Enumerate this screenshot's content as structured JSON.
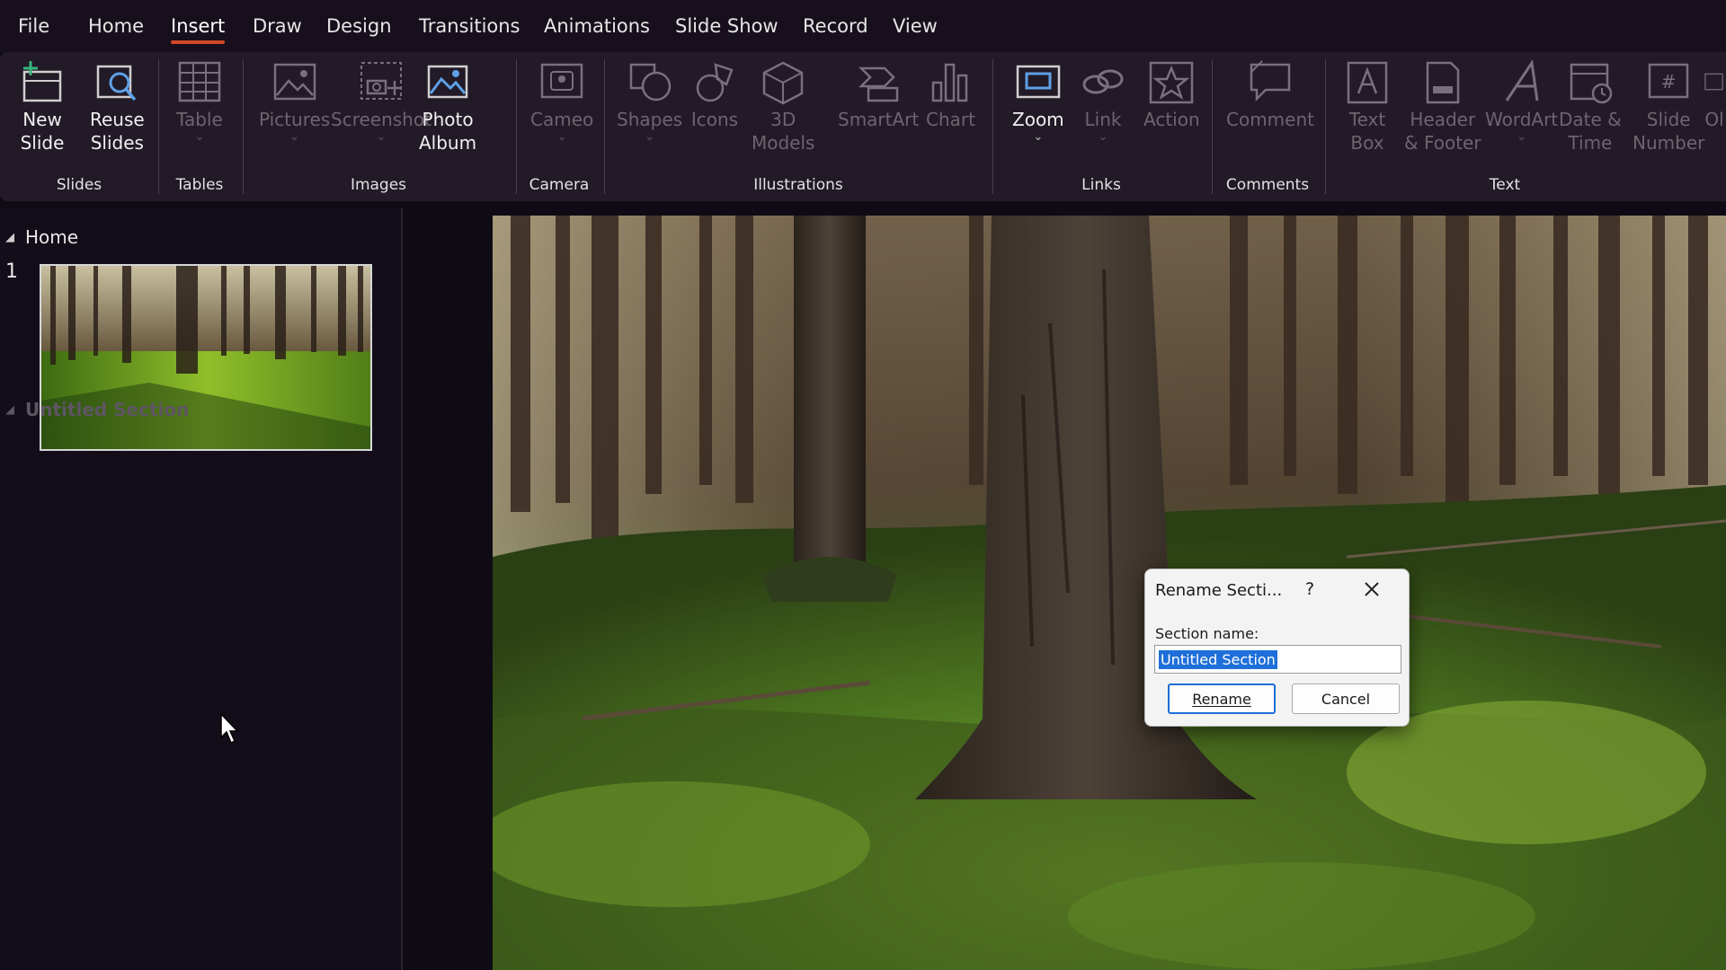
{
  "menu": {
    "items": [
      "File",
      "Home",
      "Insert",
      "Draw",
      "Design",
      "Transitions",
      "Animations",
      "Slide Show",
      "Record",
      "View"
    ],
    "active": "Insert",
    "accent_color": "#d24726"
  },
  "ribbon": {
    "groups": {
      "slides": "Slides",
      "tables": "Tables",
      "images": "Images",
      "camera": "Camera",
      "illustrations": "Illustrations",
      "links": "Links",
      "comments": "Comments",
      "text": "Text"
    },
    "buttons": {
      "new_slide": "New\nSlide",
      "reuse_slides": "Reuse\nSlides",
      "table": "Table",
      "pictures": "Pictures",
      "screenshot": "Screenshot",
      "photo_album": "Photo\nAlbum",
      "cameo": "Cameo",
      "shapes": "Shapes",
      "icons": "Icons",
      "models_3d": "3D\nModels",
      "smartart": "SmartArt",
      "chart": "Chart",
      "zoom": "Zoom",
      "link": "Link",
      "action": "Action",
      "comment": "Comment",
      "text_box": "Text\nBox",
      "header_footer": "Header\n& Footer",
      "wordart": "WordArt",
      "date_time": "Date &\nTime",
      "slide_number": "Slide\nNumber",
      "object_partial": "Ol"
    }
  },
  "thumbnails": {
    "section_home": "Home",
    "slide_number": "1",
    "section_untitled": "Untitled Section"
  },
  "dialog": {
    "title": "Rename Secti...",
    "help": "?",
    "section_name_label": "Section name:",
    "section_name_value": "Untitled Section",
    "rename_button": "Rename",
    "cancel_button": "Cancel",
    "selection_color": "#1e6fd9"
  }
}
